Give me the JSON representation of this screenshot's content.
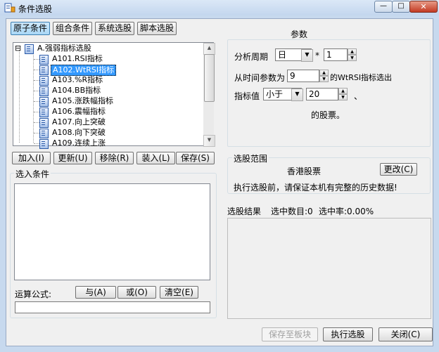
{
  "window": {
    "title": "条件选股",
    "min_glyph": "—",
    "max_glyph": "□",
    "close_glyph": "✕"
  },
  "tabs": [
    "原子条件",
    "组合条件",
    "系统选股",
    "脚本选股"
  ],
  "tree": {
    "root_label": "A.强弱指标选股",
    "expander": "⊟",
    "items": [
      "A101.RSI指标",
      "A102.WtRSI指标",
      "A103.%R指标",
      "A104.BB指标",
      "A105.涨跌幅指标",
      "A106.震幅指标",
      "A107.向上突破",
      "A108.向下突破",
      "A109.连续上涨"
    ],
    "selected_index": 1
  },
  "actions": {
    "add": "加入(I)",
    "update": "更新(U)",
    "remove": "移除(R)",
    "load": "装入(L)",
    "save": "保存(S)"
  },
  "selected_conditions": {
    "caption": "选入条件",
    "formula_label": "运算公式:",
    "and": "与(A)",
    "or": "或(O)",
    "clear": "清空(E)",
    "formula_value": ""
  },
  "params": {
    "caption": "参数",
    "period_label": "分析周期",
    "period_value": "日",
    "multiply": "*",
    "period_count": "1",
    "from_label": "从时间参数为",
    "from_value": "9",
    "from_suffix": "的WtRSI指标选出",
    "indicator_label": "指标值",
    "compare_value": "小于",
    "threshold_value": "20",
    "comma": "、",
    "tail": "的股票。"
  },
  "scope": {
    "caption": "选股范围",
    "market": "香港股票",
    "change": "更改(C)",
    "hint": "执行选股前，请保证本机有完整的历史数据!"
  },
  "results": {
    "label": "选股结果",
    "count_text": "选中数目:0",
    "rate_text": "选中率:0.00%"
  },
  "footer": {
    "save_to_block": "保存至板块",
    "execute": "执行选股",
    "close": "关闭(C)"
  },
  "colors": {
    "selection": "#3399ff",
    "close_button": "#c33a22",
    "frame": "#c7d9ee"
  }
}
